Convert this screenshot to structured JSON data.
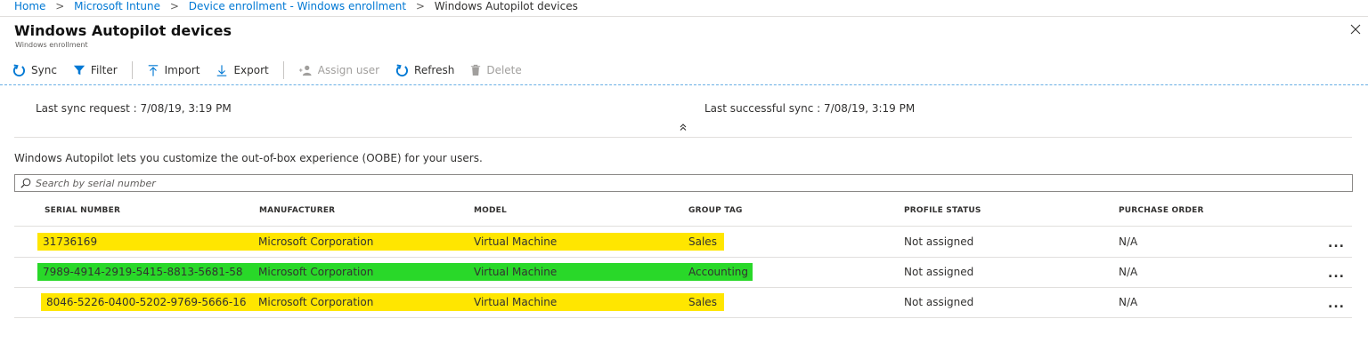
{
  "breadcrumb": {
    "home": "Home",
    "intune": "Microsoft Intune",
    "enrollment": "Device enrollment - Windows enrollment",
    "current": "Windows Autopilot devices",
    "separator": ">"
  },
  "header": {
    "title": "Windows Autopilot devices",
    "subtitle": "Windows enrollment"
  },
  "toolbar": {
    "sync": "Sync",
    "filter": "Filter",
    "import": "Import",
    "export": "Export",
    "assign_user": "Assign user",
    "refresh": "Refresh",
    "delete": "Delete"
  },
  "sync_info": {
    "last_request": "Last sync request : 7/08/19, 3:19 PM",
    "last_success": "Last successful sync : 7/08/19, 3:19 PM"
  },
  "description": "Windows Autopilot lets you customize the out-of-box experience (OOBE) for your users.",
  "search": {
    "placeholder": "Search by serial number",
    "value": ""
  },
  "table": {
    "columns": {
      "serial": "SERIAL NUMBER",
      "manufacturer": "MANUFACTURER",
      "model": "MODEL",
      "group_tag": "GROUP TAG",
      "profile_status": "PROFILE STATUS",
      "purchase_order": "PURCHASE ORDER"
    },
    "rows": [
      {
        "serial": "31736169",
        "manufacturer": "Microsoft Corporation",
        "model": "Virtual Machine",
        "group_tag": "Sales",
        "profile_status": "Not assigned",
        "purchase_order": "N/A",
        "more": "...",
        "highlight": "yellow"
      },
      {
        "serial": "7989-4914-2919-5415-8813-5681-58",
        "manufacturer": "Microsoft Corporation",
        "model": "Virtual Machine",
        "group_tag": "Accounting",
        "profile_status": "Not assigned",
        "purchase_order": "N/A",
        "more": "...",
        "highlight": "green"
      },
      {
        "serial": "8046-5226-0400-5202-9769-5666-16",
        "manufacturer": "Microsoft Corporation",
        "model": "Virtual Machine",
        "group_tag": "Sales",
        "profile_status": "Not assigned",
        "purchase_order": "N/A",
        "more": "...",
        "highlight": "yellow"
      }
    ]
  },
  "colors": {
    "accent": "#0078d4",
    "highlight_yellow": "#ffe600",
    "highlight_green": "#29d829"
  },
  "icons": {
    "sync": "sync-icon",
    "filter": "filter-icon",
    "import": "import-icon",
    "export": "export-icon",
    "assign_user": "assign-user-icon",
    "refresh": "refresh-icon",
    "delete": "delete-icon",
    "close": "close-icon",
    "search": "search-icon",
    "collapse": "collapse-up-icon"
  }
}
